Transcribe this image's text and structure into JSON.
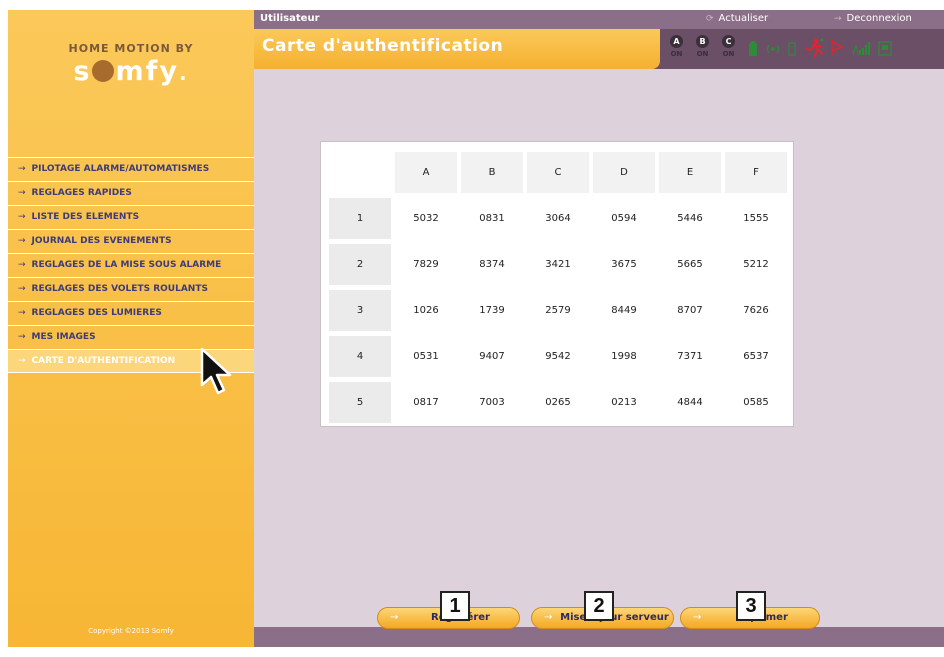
{
  "sidebar": {
    "brand_top": "HOME MOTION BY",
    "brand_logo_start": "s",
    "brand_logo_end": "mfy",
    "brand_logo_dot": ".",
    "items": [
      {
        "label": "PILOTAGE ALARME/AUTOMATISMES"
      },
      {
        "label": "REGLAGES RAPIDES"
      },
      {
        "label": "LISTE DES ELEMENTS"
      },
      {
        "label": "JOURNAL DES EVENEMENTS"
      },
      {
        "label": "REGLAGES DE LA MISE SOUS ALARME"
      },
      {
        "label": "REGLAGES DES VOLETS ROULANTS"
      },
      {
        "label": "REGLAGES DES LUMIERES"
      },
      {
        "label": "MES IMAGES"
      },
      {
        "label": "CARTE D'AUTHENTIFICATION",
        "active": true
      }
    ],
    "copyright": "Copyright ©2013 Somfy"
  },
  "header": {
    "user_label": "Utilisateur",
    "refresh_label": "Actualiser",
    "logout_label": "Deconnexion",
    "page_title": "Carte d'authentification",
    "zones": [
      {
        "letter": "A",
        "state": "ON"
      },
      {
        "letter": "B",
        "state": "ON"
      },
      {
        "letter": "C",
        "state": "ON"
      }
    ],
    "status_icons": [
      "battery-icon",
      "radio-signal-icon",
      "door-sensor-icon",
      "intrusion-alert-icon",
      "flag-icon",
      "gsm-signal-icon",
      "ethernet-icon"
    ]
  },
  "auth_card": {
    "columns": [
      "A",
      "B",
      "C",
      "D",
      "E",
      "F"
    ],
    "rows": [
      {
        "label": "1",
        "values": [
          "5032",
          "0831",
          "3064",
          "0594",
          "5446",
          "1555"
        ]
      },
      {
        "label": "2",
        "values": [
          "7829",
          "8374",
          "3421",
          "3675",
          "5665",
          "5212"
        ]
      },
      {
        "label": "3",
        "values": [
          "1026",
          "1739",
          "2579",
          "8449",
          "8707",
          "7626"
        ]
      },
      {
        "label": "4",
        "values": [
          "0531",
          "9407",
          "9542",
          "1998",
          "7371",
          "6537"
        ]
      },
      {
        "label": "5",
        "values": [
          "0817",
          "7003",
          "0265",
          "0213",
          "4844",
          "0585"
        ]
      }
    ]
  },
  "footer": {
    "regenerate_label": "Régénérer",
    "server_update_label": "Mise à jour serveur",
    "print_label": "Imprimer"
  },
  "callouts": [
    "1",
    "2",
    "3"
  ],
  "colors": {
    "sidebar_gold": "#f7b634",
    "header_mauve": "#8b6f88",
    "title_bar_dark": "#6a4f66",
    "content_bg": "#ddd2db",
    "nav_text": "#3f3a7a"
  }
}
